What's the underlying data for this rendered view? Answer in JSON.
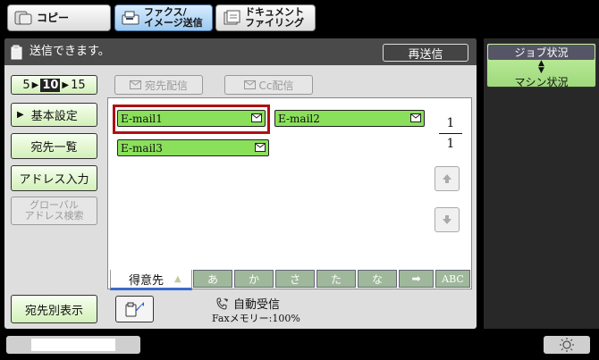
{
  "tabs": [
    {
      "label": "コピー",
      "icon": "copy-icon",
      "active": false
    },
    {
      "label_lines": [
        "ファクス/",
        "イメージ送信"
      ],
      "icon": "fax-icon",
      "active": true
    },
    {
      "label_lines": [
        "ドキュメント",
        "ファイリング"
      ],
      "icon": "filing-icon",
      "active": false
    }
  ],
  "status": {
    "message": "送信できます。",
    "icon": "document-icon",
    "resend_label": "再送信"
  },
  "side": {
    "job_label": "ジョブ状況",
    "machine_label": "マシン状況",
    "icon": "up-down-arrows-icon"
  },
  "pager": {
    "prev": "5",
    "current": "10",
    "next": "15"
  },
  "dest_buttons": {
    "to": "宛先配信",
    "cc": "Cc配信"
  },
  "left_menu": {
    "basic": "基本設定",
    "dest_list": "宛先一覧",
    "addr_input": "アドレス入力",
    "global_lines": [
      "グローバル",
      "アドレス検索"
    ],
    "dest_view": "宛先別表示"
  },
  "entries": [
    "E-mail1",
    "E-mail2",
    "E-mail3"
  ],
  "page_indicator": {
    "current": "1",
    "total": "1"
  },
  "index_tabs": {
    "active": "得意先",
    "kana": [
      "あ",
      "か",
      "さ",
      "た",
      "な"
    ],
    "abc": "ABC"
  },
  "fax_info": {
    "receive": "自動受信",
    "memory": "Faxメモリー:100%"
  },
  "colors": {
    "entry_green": "#8ae05a",
    "selection_red": "#b01010",
    "active_tab": "#9cc8ee",
    "index_tab": "#9fb89b"
  }
}
